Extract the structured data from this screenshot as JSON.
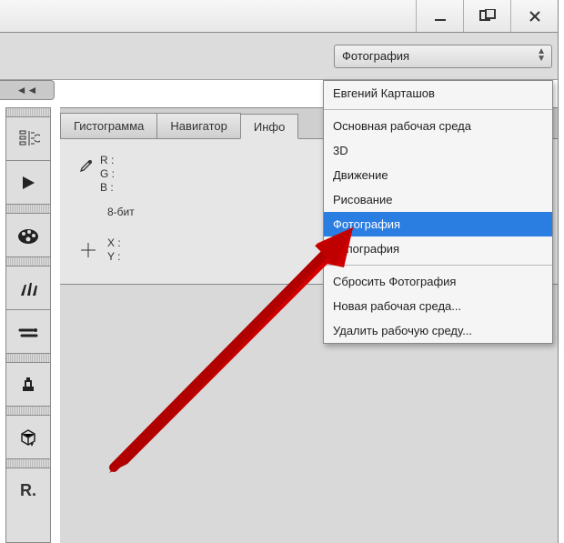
{
  "window": {
    "minimize": "—",
    "maximize": "❐",
    "close": "✕"
  },
  "workspace_dropdown": {
    "selected": "Фотография"
  },
  "collapse_label": "◄◄",
  "tabs": {
    "histogram": "Гистограмма",
    "navigator": "Навигатор",
    "info": "Инфо"
  },
  "info_panel": {
    "ch_r": "R :",
    "ch_g": "G :",
    "ch_b": "B :",
    "bit_depth": "8-бит",
    "x": "X :",
    "y": "Y :"
  },
  "workspace_menu": {
    "user": "Евгений Карташов",
    "essentials": "Основная рабочая среда",
    "3d": "3D",
    "motion": "Движение",
    "painting": "Рисование",
    "photography": "Фотография",
    "typography": "Типография",
    "reset": "Сбросить Фотография",
    "new": "Новая рабочая среда...",
    "delete": "Удалить рабочую среду..."
  },
  "tool_last": "R."
}
